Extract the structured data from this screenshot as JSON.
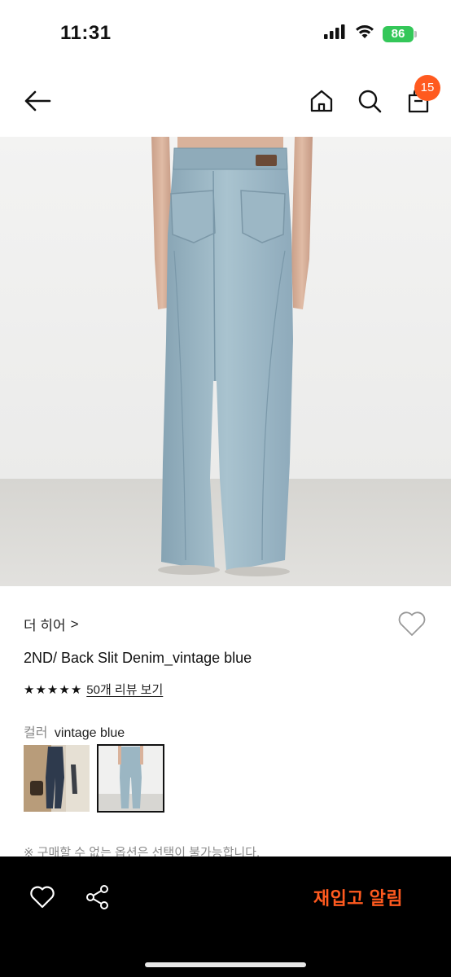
{
  "status_bar": {
    "time": "11:31",
    "battery": "86",
    "icons": [
      "signal-icon",
      "wifi-icon",
      "battery-icon"
    ]
  },
  "nav": {
    "icons": [
      "back-arrow-icon",
      "home-icon",
      "search-icon",
      "shopping-bag-icon"
    ],
    "cart_count": "15"
  },
  "product": {
    "brand": "더 히어",
    "brand_chevron": ">",
    "title": "2ND/ Back Slit Denim_vintage blue",
    "rating_stars": 5,
    "review_link": "50개 리뷰 보기",
    "color_label": "컬러",
    "color_value": "vintage blue",
    "notice": "※ 구매할 수 없는 옵션은 선택이 불가능합니다."
  },
  "swatches": [
    {
      "name": "dark-denim",
      "selected": false
    },
    {
      "name": "vintage-blue",
      "selected": true
    }
  ],
  "bottom_bar": {
    "icons": [
      "heart-icon",
      "share-icon"
    ],
    "restock_label": "재입고 알림"
  },
  "colors": {
    "accent": "#ff5a1f",
    "battery_green": "#34c759",
    "denim": "#9bb6c3",
    "bottom_bar_bg": "#000000"
  }
}
